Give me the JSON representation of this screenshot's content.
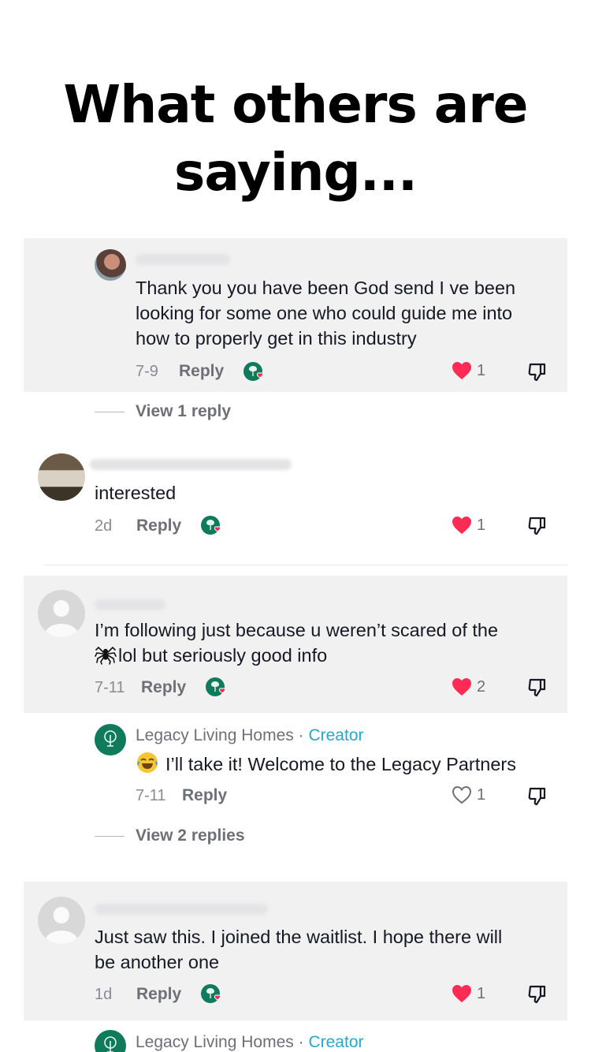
{
  "title_line1": "What others are",
  "title_line2": "saying...",
  "comments": [
    {
      "text_line1": "Thank you you have been God send I ve been",
      "text_line2": "looking for some one who could guide me into",
      "text_line3": "how to properly get in this industry",
      "date": "7-9",
      "reply_label": "Reply",
      "likes": "1",
      "view_replies": "View 1 reply"
    },
    {
      "text_line1": "interested",
      "date": "2d",
      "reply_label": "Reply",
      "likes": "1"
    },
    {
      "text_line1": "I’m following just because u weren’t scared of the",
      "text_line2": "lol but seriously good info",
      "date": "7-11",
      "reply_label": "Reply",
      "likes": "2",
      "creator_reply": {
        "name": "Legacy Living Homes",
        "separator": "·",
        "badge": "Creator",
        "text": "I’ll take it! Welcome to the Legacy Partners",
        "date": "7-11",
        "reply_label": "Reply",
        "likes": "1"
      },
      "view_replies": "View 2 replies"
    },
    {
      "text_line1": "Just saw this. I joined the waitlist. I hope there will",
      "text_line2": "be another one",
      "date": "1d",
      "reply_label": "Reply",
      "likes": "1"
    }
  ],
  "bottom_reply": {
    "name": "Legacy Living Homes",
    "separator": "·",
    "badge": "Creator"
  },
  "colors": {
    "heart": "#fe2c55",
    "creator_badge": "#26a8c7",
    "brand_green": "#0f7a5c",
    "band": "#f1f1f2"
  },
  "icons": [
    "heart-icon",
    "heart-outline-icon",
    "dislike-icon",
    "creator-liked-icon",
    "spider-icon",
    "laughing-emoji-icon"
  ]
}
